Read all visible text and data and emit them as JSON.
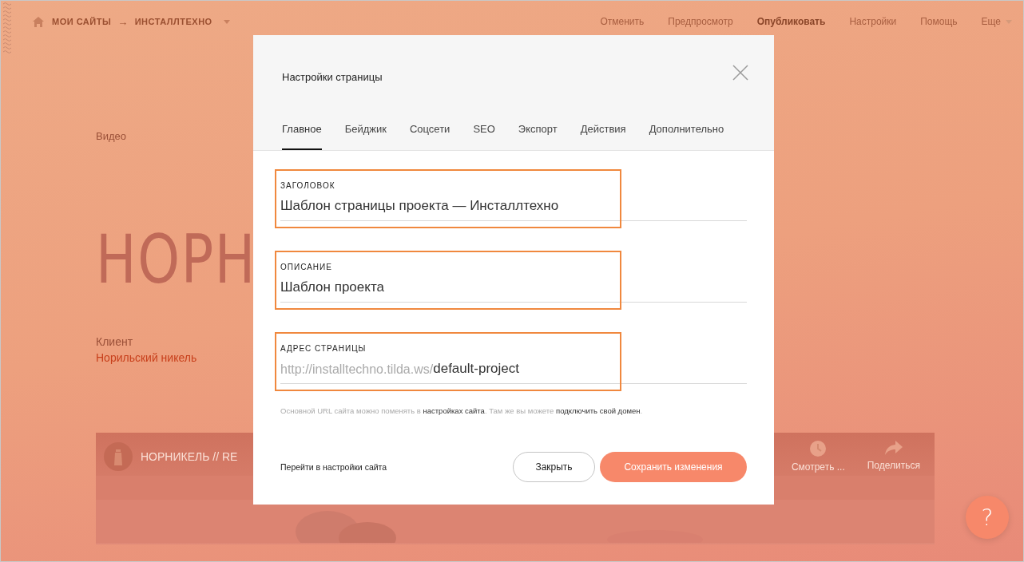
{
  "topbar": {
    "breadcrumb": [
      "МОИ САЙТЫ",
      "→",
      "ИНСТАЛЛТЕХНО"
    ],
    "menu": [
      {
        "label": "Отменить",
        "bold": false
      },
      {
        "label": "Предпросмотр",
        "bold": false
      },
      {
        "label": "Опубликовать",
        "bold": true
      },
      {
        "label": "Настройки",
        "bold": false
      },
      {
        "label": "Помощь",
        "bold": false
      },
      {
        "label": "Еще",
        "bold": false
      }
    ]
  },
  "page": {
    "category": "Видео",
    "title": "НОРН",
    "client_label": "Клиент",
    "client": "Норильский никель",
    "video": {
      "title": "НОРНИКЕЛЬ // RE",
      "actions": [
        {
          "kind": "clock",
          "label": "Смотреть ..."
        },
        {
          "kind": "share",
          "label": "Поделиться"
        }
      ]
    }
  },
  "modal": {
    "title": "Настройки страницы",
    "tabs": [
      {
        "label": "Главное",
        "selected": true
      },
      {
        "label": "Бейджик",
        "selected": false
      },
      {
        "label": "Соцсети",
        "selected": false
      },
      {
        "label": "SEO",
        "selected": false
      },
      {
        "label": "Экспорт",
        "selected": false
      },
      {
        "label": "Действия",
        "selected": false
      },
      {
        "label": "Дополнительно",
        "selected": false
      }
    ],
    "fields": [
      {
        "label": "ЗАГОЛОВОК",
        "value": "Шаблон страницы проекта — Инсталлтехно",
        "highlighted": true
      },
      {
        "label": "ОПИСАНИЕ",
        "value": "Шаблон проекта",
        "highlighted": true
      },
      {
        "label": "АДРЕС СТРАНИЦЫ",
        "prefix": "http://installtechno.tilda.ws/",
        "value": "default-project",
        "highlighted": true
      }
    ],
    "hint": "Основной URL сайта можно поменять в **настройках сайта**. Там же вы можете **подключить свой домен**.",
    "settings_link": "Перейти в настройки сайта",
    "buttons": [
      {
        "kind": "secondary",
        "label": "Закрыть"
      },
      {
        "kind": "primary",
        "label": "Сохранить изменения"
      }
    ]
  },
  "help_button": "?"
}
